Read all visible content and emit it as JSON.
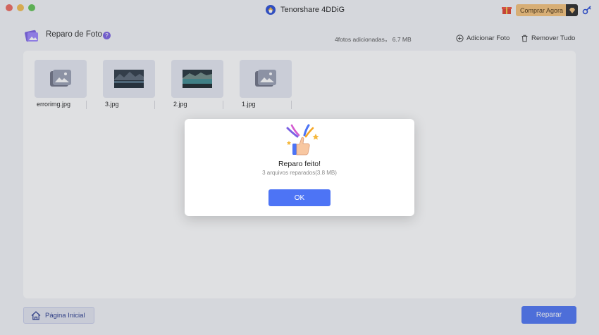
{
  "window": {
    "app_title": "Tenorshare 4DDiG",
    "buy_label": "Comprar Agora"
  },
  "header": {
    "title": "Reparo de Foto",
    "help_mark": "?",
    "summary": "4fotos adicionadas， 6.7 MB",
    "add_label": "Adicionar Foto",
    "remove_label": "Remover Tudo"
  },
  "files": [
    {
      "name": "errorimg.jpg",
      "thumb": "broken-image-icon"
    },
    {
      "name": "3.jpg",
      "thumb": "lake-photo"
    },
    {
      "name": "2.jpg",
      "thumb": "lake-photo"
    },
    {
      "name": "1.jpg",
      "thumb": "broken-image-icon"
    }
  ],
  "footer": {
    "home_label": "Página Inicial",
    "repair_label": "Reparar"
  },
  "dialog": {
    "title": "Reparo feito!",
    "subtitle": "3 arquivos reparados(3.8 MB)",
    "ok_label": "OK",
    "icon": "thumbs-up-celebration-icon"
  },
  "colors": {
    "accent": "#4d74f5",
    "buy_button": "#f6c27a",
    "help_badge": "#7b61e3"
  }
}
